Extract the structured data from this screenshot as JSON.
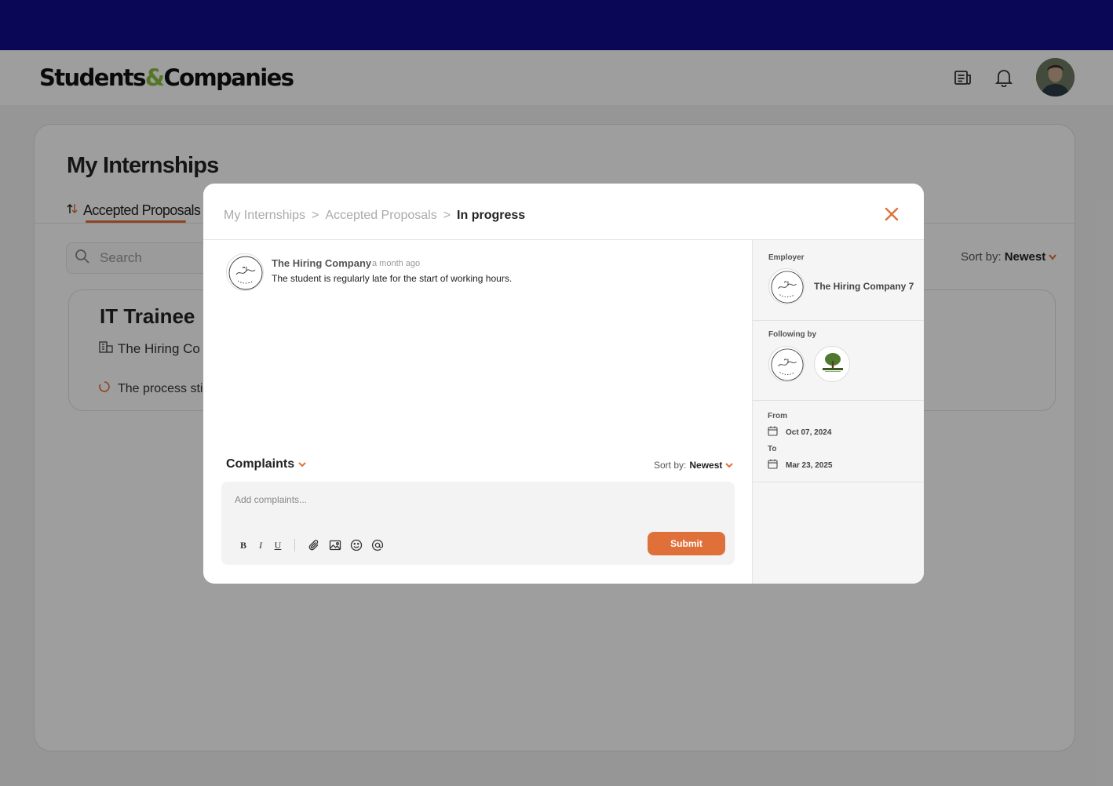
{
  "colors": {
    "topbar": "#0b0757",
    "accent": "#e0703a",
    "logo_amp": "#8cbf3f",
    "overlay": "rgba(0,0,0,0.38)"
  },
  "header": {
    "logo_left": "Students",
    "logo_amp": "&",
    "logo_right": "Companies",
    "icons": [
      "news-icon",
      "bell-icon"
    ],
    "avatar": "user-avatar"
  },
  "page": {
    "title": "My Internships",
    "tab_label": "Accepted Proposals",
    "search_placeholder": "Search",
    "sort_label": "Sort by:",
    "sort_value": "Newest",
    "internship": {
      "title": "IT Trainee",
      "company": "The Hiring Co",
      "status": "The process sti"
    }
  },
  "modal": {
    "breadcrumb": [
      "My Internships",
      "Accepted Proposals",
      "In progress"
    ],
    "breadcrumb_sep": ">",
    "comment": {
      "author": "The Hiring Company",
      "time": "a month ago",
      "text": "The student is regularly late for the start of working hours."
    },
    "complaints": {
      "title": "Complaints",
      "sort_label": "Sort by:",
      "sort_value": "Newest",
      "placeholder": "Add complaints...",
      "submit_label": "Submit",
      "toolbar": {
        "bold": "B",
        "italic": "I",
        "underline": "U"
      }
    },
    "sidebar": {
      "employer_label": "Employer",
      "employer_name": "The Hiring Company 7",
      "following_label": "Following by",
      "from_label": "From",
      "from_date": "Oct 07, 2024",
      "to_label": "To",
      "to_date": "Mar 23, 2025"
    }
  }
}
